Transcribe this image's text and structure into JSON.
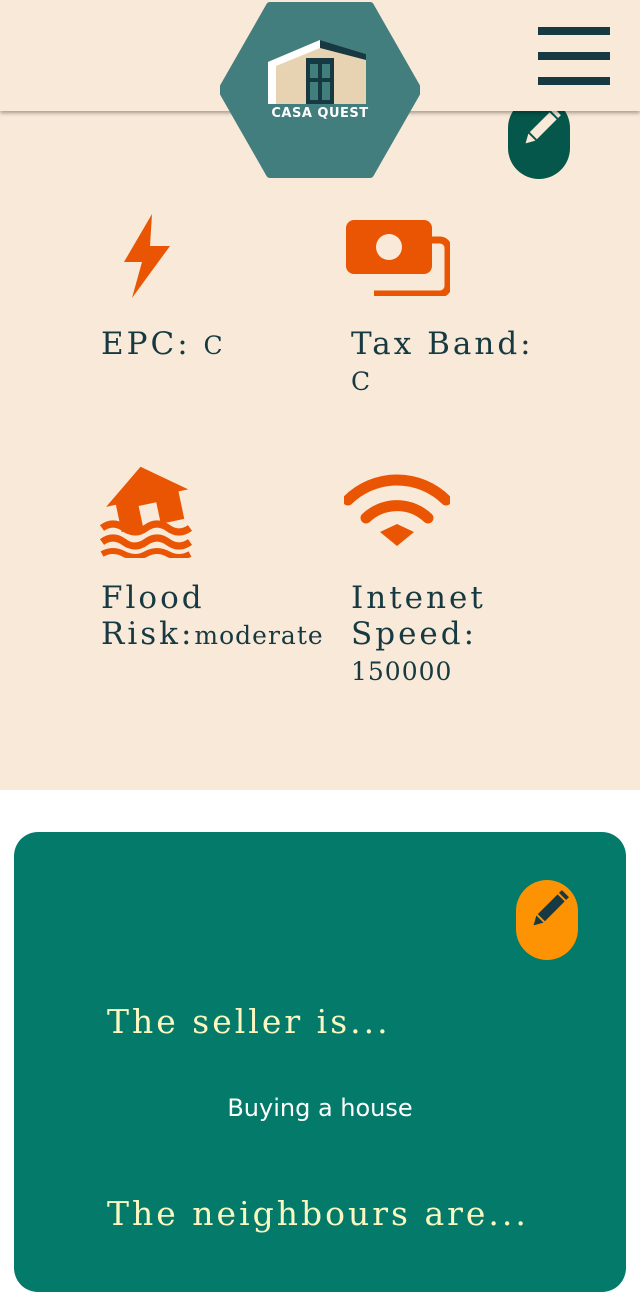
{
  "header": {
    "logo_text": "CASA QUEST",
    "menu_icon": "hamburger-menu-icon"
  },
  "colors": {
    "cream": "#f9e9d8",
    "teal": "#037a6a",
    "dark_teal": "#04574a",
    "navy": "#173a42",
    "orange": "#ea5504",
    "amber": "#fd9202",
    "pale_yellow": "#fbf7c0"
  },
  "property": {
    "edit_icon": "pencil-icon",
    "features": [
      {
        "icon": "lightning-bolt-icon",
        "label": "EPC:",
        "value": "C"
      },
      {
        "icon": "money-bills-icon",
        "label": "Tax Band:",
        "value": "C"
      },
      {
        "icon": "flooded-house-icon",
        "label_line1": "Flood",
        "label_line2": "Risk:",
        "value": "moderate"
      },
      {
        "icon": "wifi-icon",
        "label_line1": "Intenet",
        "label_line2": "Speed:",
        "value": "150000"
      }
    ]
  },
  "seller_card": {
    "edit_icon": "pencil-icon",
    "seller_heading": "The seller is...",
    "seller_text": "Buying a house",
    "neighbours_heading": "The neighbours are..."
  }
}
